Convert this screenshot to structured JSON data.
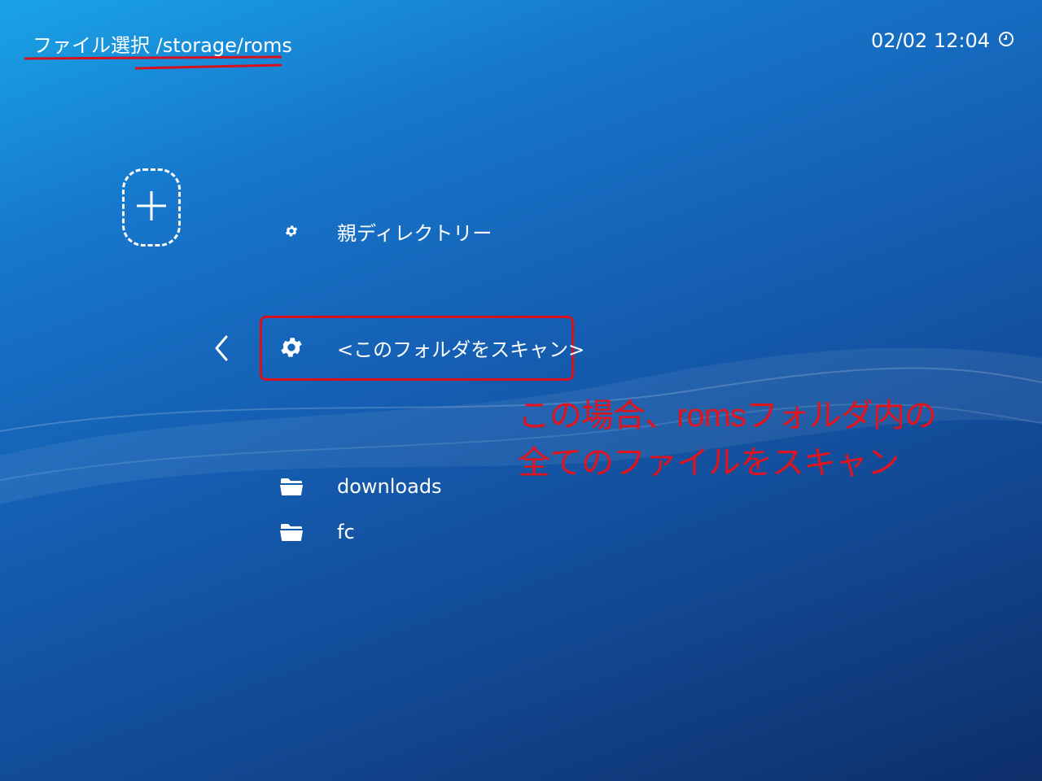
{
  "header": {
    "title": "ファイル選択 /storage/roms",
    "datetime": "02/02 12:04",
    "clock_icon": "clock-icon"
  },
  "add_tile": {
    "icon": "plus-icon"
  },
  "list": {
    "back_icon": "chevron-left-icon",
    "items": [
      {
        "icon": "gear-icon",
        "label": "親ディレクトリー"
      },
      {
        "icon": "gear-icon",
        "label": "<このフォルダをスキャン>",
        "selected": true
      },
      {
        "icon": "folder-icon",
        "label": "downloads"
      },
      {
        "icon": "folder-icon",
        "label": "fc"
      }
    ]
  },
  "annotation": {
    "line1": "この場合、romsフォルダ内の",
    "line2": "全てのファイルをスキャン",
    "color": "#e0141e"
  },
  "colors": {
    "background_top": "#1aa3e6",
    "background_bottom": "#0e2f6a",
    "highlight_red": "#d8101d",
    "text": "#ffffff"
  }
}
